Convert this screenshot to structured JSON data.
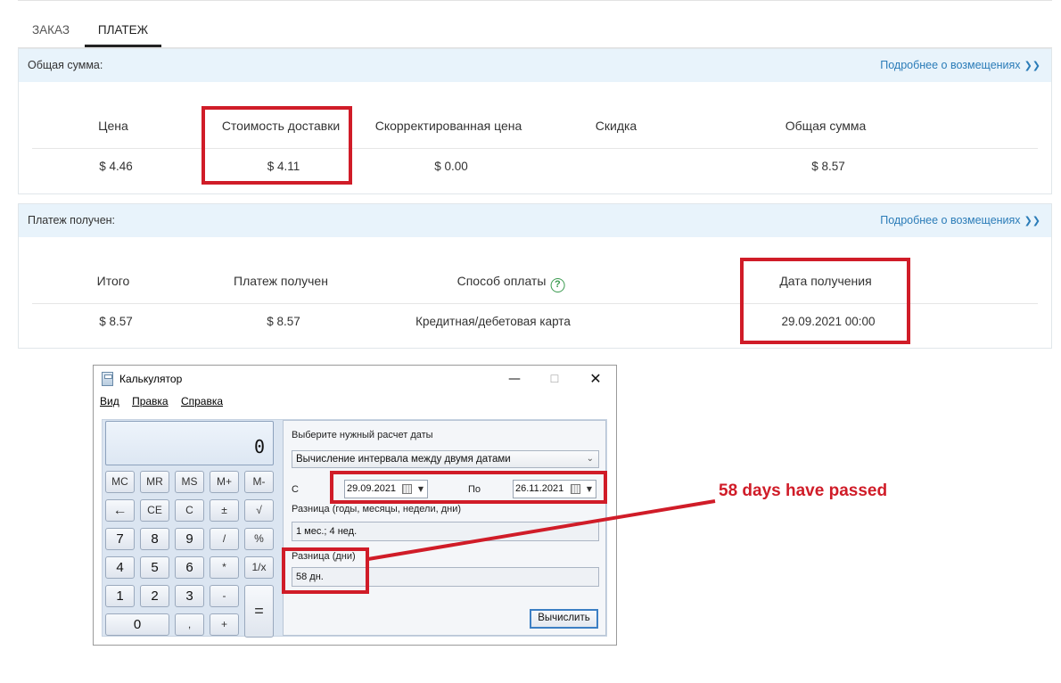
{
  "tabs": [
    {
      "label": "ЗАКАЗ",
      "active": false
    },
    {
      "label": "ПЛАТЕЖ",
      "active": true
    }
  ],
  "total_panel": {
    "title": "Общая сумма:",
    "link": "Подробнее о возмещениях",
    "headers": [
      "Цена",
      "Стоимость доставки",
      "Скорректированная цена",
      "Скидка",
      "Общая сумма"
    ],
    "values": [
      "$ 4.46",
      "$ 4.11",
      "$ 0.00",
      "",
      "$ 8.57"
    ]
  },
  "payment_panel": {
    "title": "Платеж получен:",
    "link": "Подробнее о возмещениях",
    "headers": [
      "Итого",
      "Платеж получен",
      "Способ оплаты",
      "Дата получения"
    ],
    "values": [
      "$ 8.57",
      "$ 8.57",
      "Кредитная/дебетовая карта",
      "29.09.2021 00:00"
    ],
    "help_symbol": "?"
  },
  "calculator": {
    "title": "Калькулятор",
    "window_controls": {
      "minimize": "—",
      "maximize": "☐",
      "close": "✕"
    },
    "menu": [
      "Вид",
      "Правка",
      "Справка"
    ],
    "display": "0",
    "keys": {
      "row1": [
        "MC",
        "MR",
        "MS",
        "M+",
        "M-"
      ],
      "row2": [
        "←",
        "CE",
        "C",
        "±",
        "√"
      ],
      "row3": [
        "7",
        "8",
        "9",
        "/",
        "%"
      ],
      "row4": [
        "4",
        "5",
        "6",
        "*",
        "1/x"
      ],
      "row5": [
        "1",
        "2",
        "3",
        "-"
      ],
      "row6": [
        "0",
        ",",
        "+"
      ],
      "equals": "="
    },
    "date_calc": {
      "prompt": "Выберите нужный расчет даты",
      "mode": "Вычисление интервала между двумя датами",
      "from_label": "С",
      "from_date": "29.09.2021",
      "to_label": "По",
      "to_date": "26.11.2021",
      "diff_label": "Разница (годы, месяцы, недели, дни)",
      "diff_value": "1 мес.; 4 нед.",
      "days_label": "Разница (дни)",
      "days_value": "58 дн.",
      "calculate_button": "Вычислить"
    }
  },
  "annotation": {
    "text": "58 days have passed",
    "color": "#d01c28"
  },
  "colors": {
    "accent": "#2b7cb8",
    "highlight": "#d01c28",
    "panel_header": "#e8f3fb",
    "help_icon": "#3a9a4f"
  }
}
